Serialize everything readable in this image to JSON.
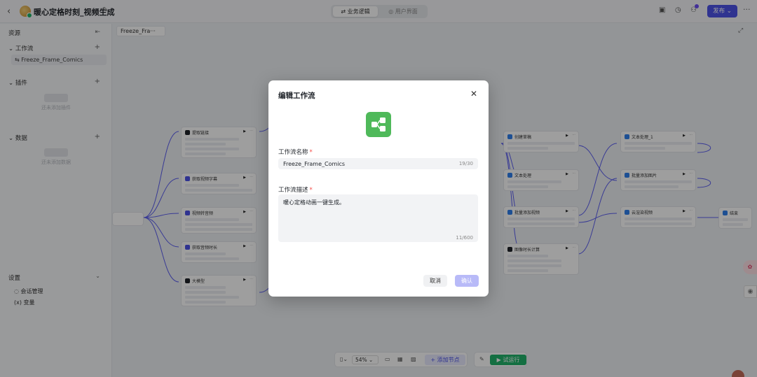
{
  "header": {
    "title": "暖心定格时刻_视频生成",
    "tabs": [
      {
        "label": "业务逻辑",
        "active": true
      },
      {
        "label": "用户界面",
        "active": false
      }
    ],
    "publish_label": "发布"
  },
  "sidebar": {
    "resources_label": "资源",
    "workflow_label": "工作流",
    "workflow_item": "Freeze_Frame_Comics",
    "plugin_label": "插件",
    "plugin_empty": "还未添加插件",
    "data_label": "数据",
    "data_empty": "还未添加数据",
    "settings_label": "设置",
    "settings_items": [
      "会话管理",
      "变量"
    ]
  },
  "canvas": {
    "tab_label": "Freeze_Fra···",
    "nodes": [
      {
        "title": "提取链接",
        "icon_color": "#1f2329"
      },
      {
        "title": "获取视频字幕",
        "icon_color": "#4d53e8"
      },
      {
        "title": "视频转音频",
        "icon_color": "#4d53e8"
      },
      {
        "title": "获取音频时长",
        "icon_color": "#4d53e8"
      },
      {
        "title": "大模型",
        "icon_color": "#1f2329"
      },
      {
        "title": "创建草稿",
        "icon_color": "#2f80ed"
      },
      {
        "title": "文本处理",
        "icon_color": "#2f80ed"
      },
      {
        "title": "批量添加视频",
        "icon_color": "#2f80ed"
      },
      {
        "title": "图像时长计算",
        "icon_color": "#1f2329"
      },
      {
        "title": "文本处理_1",
        "icon_color": "#2f80ed"
      },
      {
        "title": "批量添加图片",
        "icon_color": "#2f80ed"
      },
      {
        "title": "云渲染视频",
        "icon_color": "#2f80ed"
      },
      {
        "title": "结束",
        "icon_color": "#2f80ed"
      }
    ]
  },
  "toolbar": {
    "zoom": "54%",
    "add_node_label": "添加节点",
    "run_label": "试运行"
  },
  "modal": {
    "title": "编辑工作流",
    "name_label": "工作流名称",
    "name_value": "Freeze_Frame_Comics",
    "name_count": "19/30",
    "desc_label": "工作流描述",
    "desc_value": "暖心定格动画一键生成。",
    "desc_count": "11/600",
    "cancel_label": "取消",
    "confirm_label": "确认"
  }
}
